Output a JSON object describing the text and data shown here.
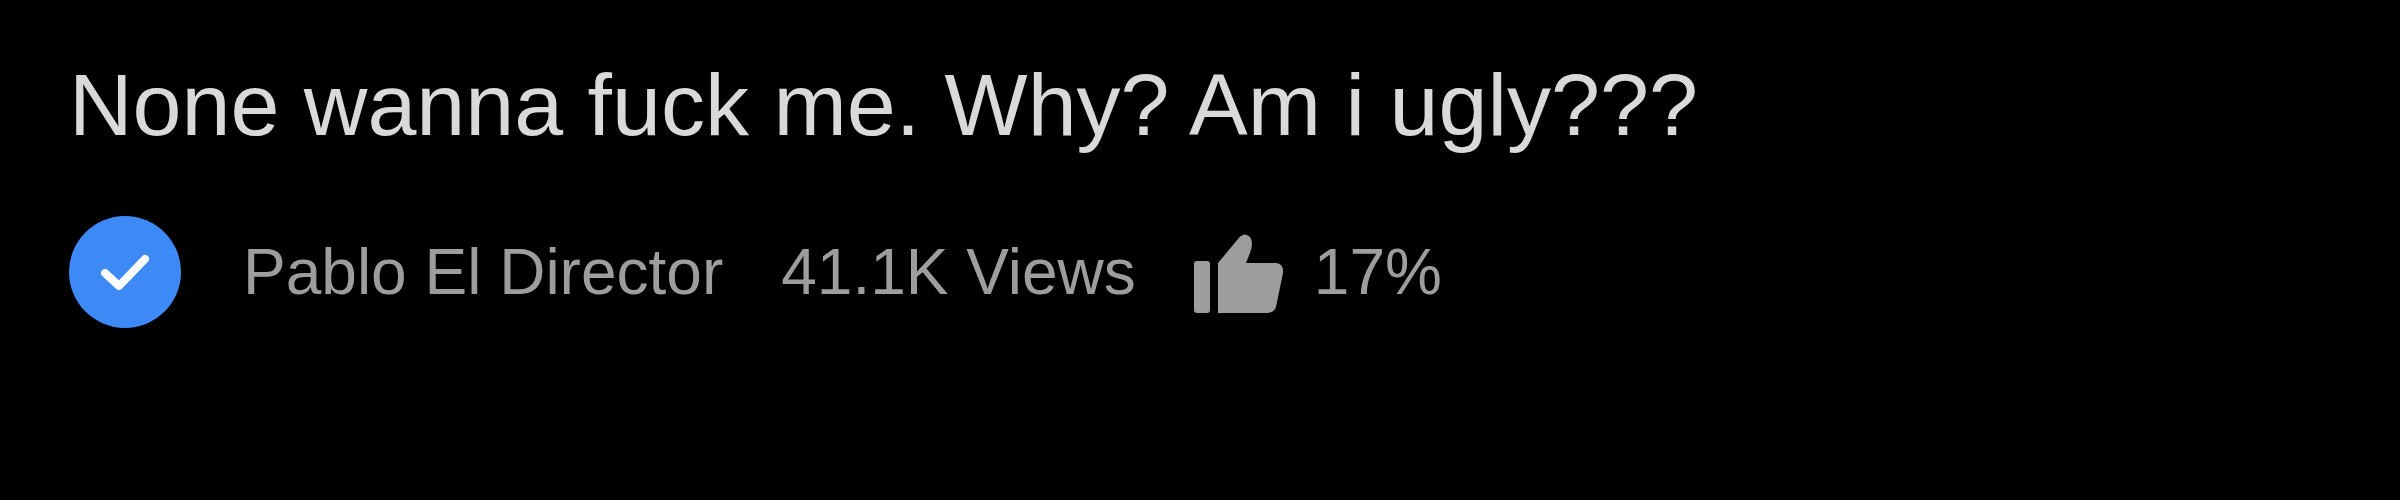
{
  "video": {
    "title": "None wanna fuck me. Why? Am i ugly???",
    "channel": {
      "name": "Pablo El Director",
      "verified": true
    },
    "views": "41.1K Views",
    "rating": "17%"
  }
}
